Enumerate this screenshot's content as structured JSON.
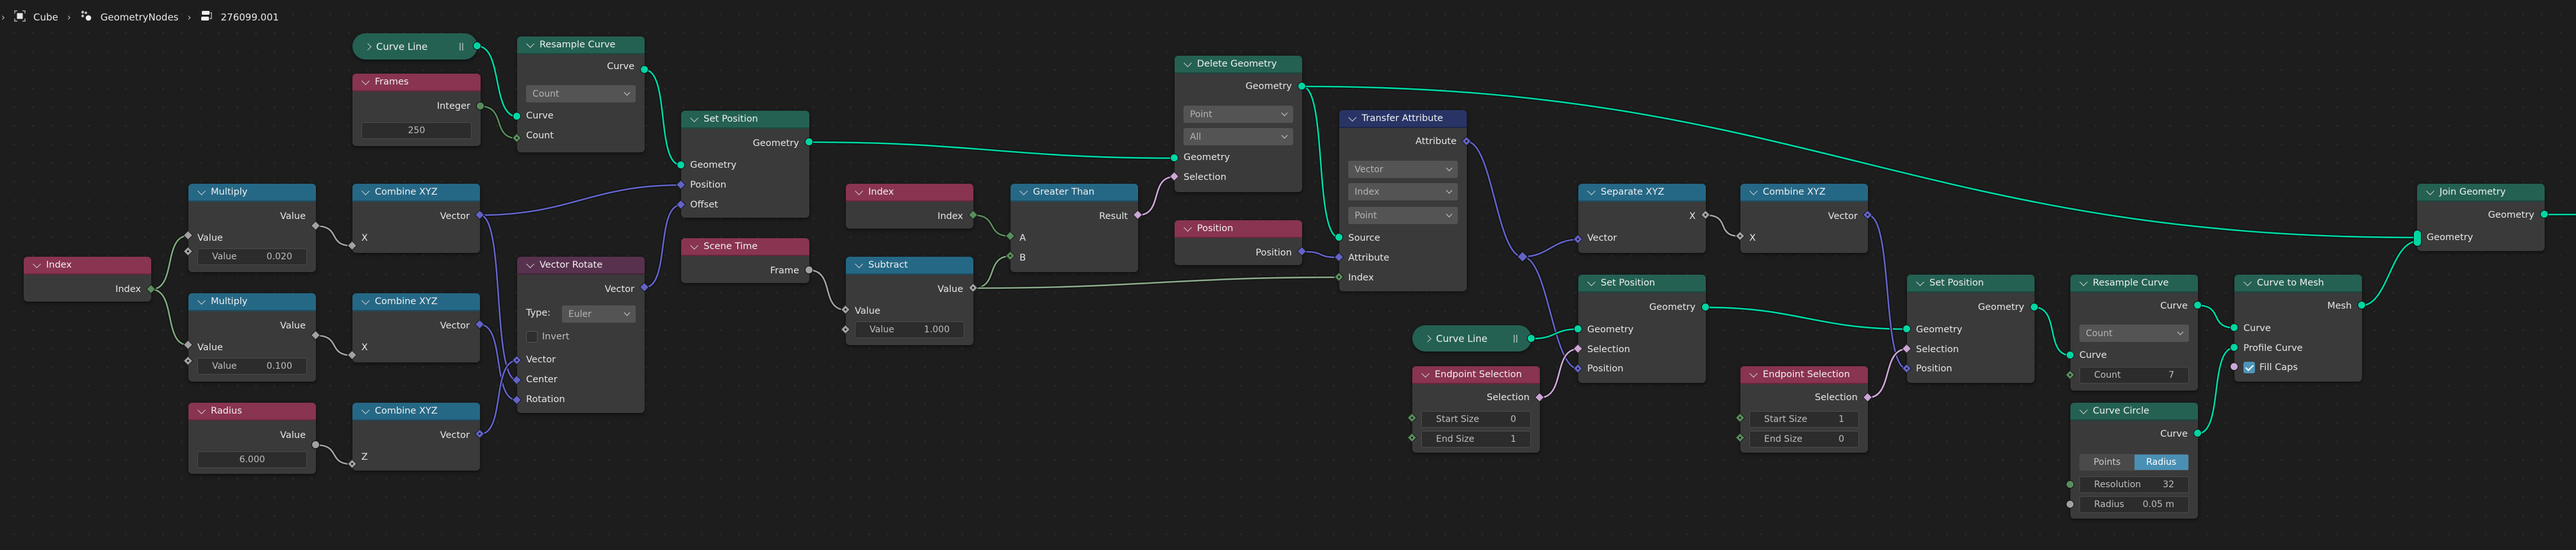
{
  "breadcrumb": {
    "items": [
      {
        "label": "Cube",
        "icon": "object-icon"
      },
      {
        "label": "GeometryNodes",
        "icon": "geometry-nodes-modifier-icon"
      },
      {
        "label": "276099.001",
        "icon": "node-tree-icon"
      }
    ]
  },
  "colors": {
    "geometry_socket": "#00d6a3",
    "vector_socket": "#6363c7",
    "float_socket": "#a1a1a1",
    "int_socket": "#598c5c",
    "bool_socket": "#cca6d6",
    "header_geometry": "#246153",
    "header_input": "#893450",
    "header_converter": "#256886",
    "header_vector": "#58314e",
    "header_attribute": "#293466",
    "accent": "#4a8fb4"
  },
  "nodes": {
    "curve_line_1": {
      "title": "Curve Line"
    },
    "frames": {
      "title": "Frames",
      "output": "Integer",
      "value": "250"
    },
    "resample_curve_1": {
      "title": "Resample Curve",
      "output": "Curve",
      "mode": "Count",
      "inputs": [
        "Curve",
        "Count"
      ]
    },
    "set_position_1": {
      "title": "Set Position",
      "output": "Geometry",
      "inputs": [
        "Geometry",
        "Position",
        "Offset"
      ]
    },
    "index_1": {
      "title": "Index",
      "output": "Index"
    },
    "multiply_1": {
      "title": "Multiply",
      "output": "Value",
      "input": "Value",
      "field_label": "Value",
      "field_value": "0.020"
    },
    "multiply_2": {
      "title": "Multiply",
      "output": "Value",
      "input": "Value",
      "field_label": "Value",
      "field_value": "0.100"
    },
    "radius": {
      "title": "Radius",
      "output": "Value",
      "value": "6.000"
    },
    "combine_xyz_1": {
      "title": "Combine XYZ",
      "output": "Vector",
      "input": "X"
    },
    "combine_xyz_2": {
      "title": "Combine XYZ",
      "output": "Vector",
      "input": "X"
    },
    "combine_xyz_3": {
      "title": "Combine XYZ",
      "output": "Vector",
      "input": "Z"
    },
    "vector_rotate": {
      "title": "Vector Rotate",
      "output": "Vector",
      "type_label": "Type:",
      "type_value": "Euler",
      "invert_label": "Invert",
      "invert_checked": false,
      "inputs": [
        "Vector",
        "Center",
        "Rotation"
      ]
    },
    "scene_time": {
      "title": "Scene Time",
      "output": "Frame"
    },
    "index_2": {
      "title": "Index",
      "output": "Index"
    },
    "subtract": {
      "title": "Subtract",
      "output": "Value",
      "input": "Value",
      "field_label": "Value",
      "field_value": "1.000"
    },
    "greater_than": {
      "title": "Greater Than",
      "output": "Result",
      "inputs": [
        "A",
        "B"
      ]
    },
    "position": {
      "title": "Position",
      "output": "Position"
    },
    "delete_geometry": {
      "title": "Delete Geometry",
      "output": "Geometry",
      "domain": "Point",
      "mode": "All",
      "inputs": [
        "Geometry",
        "Selection"
      ]
    },
    "transfer_attribute": {
      "title": "Transfer Attribute",
      "output": "Attribute",
      "data_type": "Vector",
      "mapping": "Index",
      "domain": "Point",
      "inputs": [
        "Source",
        "Attribute",
        "Index"
      ]
    },
    "separate_xyz": {
      "title": "Separate XYZ",
      "output": "X",
      "input": "Vector"
    },
    "combine_xyz_4": {
      "title": "Combine XYZ",
      "output": "Vector",
      "input": "X"
    },
    "curve_line_2": {
      "title": "Curve Line"
    },
    "endpoint_selection_1": {
      "title": "Endpoint Selection",
      "output": "Selection",
      "start_label": "Start Size",
      "start_value": "0",
      "end_label": "End Size",
      "end_value": "1"
    },
    "set_position_2": {
      "title": "Set Position",
      "output": "Geometry",
      "inputs": [
        "Geometry",
        "Selection",
        "Position"
      ]
    },
    "endpoint_selection_2": {
      "title": "Endpoint Selection",
      "output": "Selection",
      "start_label": "Start Size",
      "start_value": "1",
      "end_label": "End Size",
      "end_value": "0"
    },
    "set_position_3": {
      "title": "Set Position",
      "output": "Geometry",
      "inputs": [
        "Geometry",
        "Selection",
        "Position"
      ]
    },
    "resample_curve_2": {
      "title": "Resample Curve",
      "output": "Curve",
      "mode": "Count",
      "input": "Curve",
      "field_label": "Count",
      "field_value": "7"
    },
    "curve_circle": {
      "title": "Curve Circle",
      "output": "Curve",
      "modes": [
        "Points",
        "Radius"
      ],
      "active_mode": "Radius",
      "resolution_label": "Resolution",
      "resolution_value": "32",
      "radius_label": "Radius",
      "radius_value": "0.05 m"
    },
    "curve_to_mesh": {
      "title": "Curve to Mesh",
      "output": "Mesh",
      "inputs": [
        "Curve",
        "Profile Curve"
      ],
      "fill_caps_label": "Fill Caps",
      "fill_caps_checked": true
    },
    "join_geometry": {
      "title": "Join Geometry",
      "output": "Geometry",
      "input": "Geometry"
    }
  }
}
